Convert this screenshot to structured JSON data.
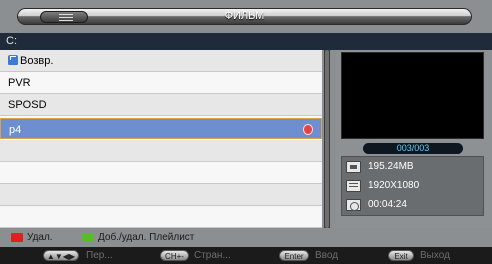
{
  "title_bar": {
    "title": "ФИЛЬМ"
  },
  "path": {
    "text": "C:"
  },
  "file_list": {
    "rows": [
      {
        "label": "Возвр.",
        "type": "back"
      },
      {
        "label": "PVR",
        "type": "folder"
      },
      {
        "label": "SPOSD",
        "type": "folder"
      },
      {
        "label": "p4",
        "type": "file",
        "selected": true
      },
      {
        "label": ""
      },
      {
        "label": ""
      },
      {
        "label": ""
      },
      {
        "label": ""
      }
    ]
  },
  "preview": {
    "counter": "003/003",
    "info": [
      {
        "icon": "file-size-icon",
        "value": "195.24MB"
      },
      {
        "icon": "resolution-icon",
        "value": "1920X1080"
      },
      {
        "icon": "duration-icon",
        "value": "00:04:24"
      }
    ]
  },
  "hints": {
    "red": {
      "color": "#e02020",
      "label": "Удал."
    },
    "green": {
      "color": "#5aba2a",
      "label": "Доб./удал. Плейлист"
    }
  },
  "buttons": [
    {
      "key": "▲▼◀▶",
      "label": "Пер..."
    },
    {
      "key": "CH+-",
      "label": "Стран..."
    },
    {
      "key": "Enter",
      "label": "Ввод"
    },
    {
      "key": "Exit",
      "label": "Выход"
    }
  ]
}
